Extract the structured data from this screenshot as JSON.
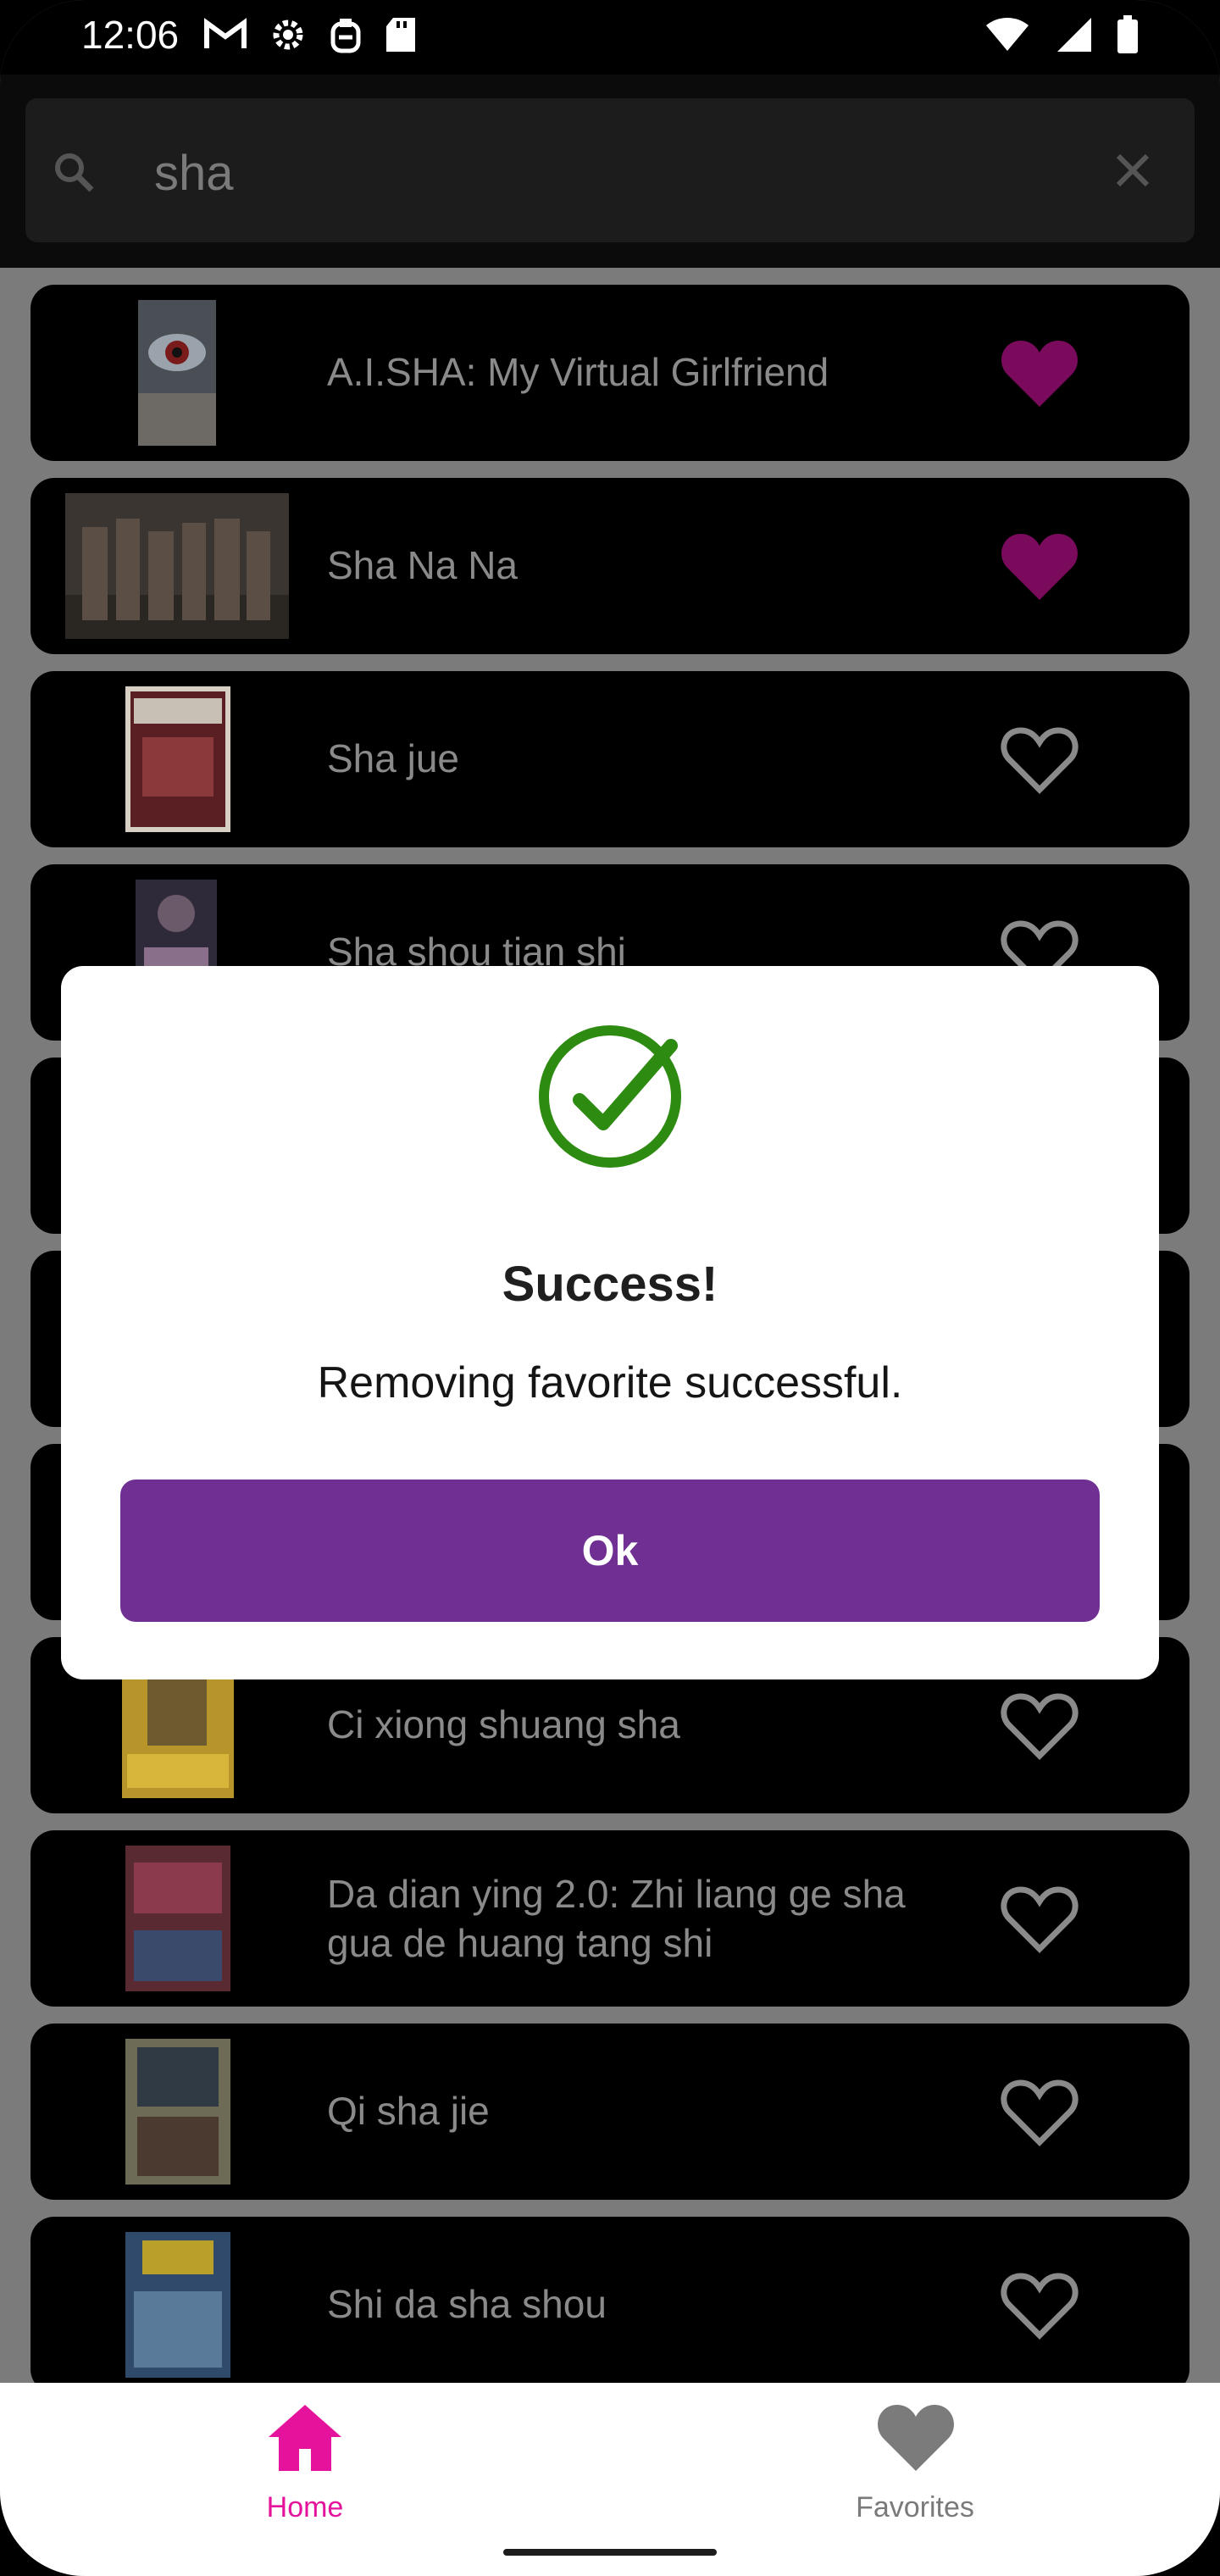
{
  "status_bar": {
    "time": "12:06",
    "left_icons": [
      "gmail-icon",
      "settings-icon",
      "clipboard-icon",
      "sd-card-icon"
    ],
    "right_icons": [
      "wifi-icon",
      "signal-icon",
      "battery-icon"
    ]
  },
  "search": {
    "value": "sha",
    "search_icon": "search-icon",
    "clear_icon": "close-icon"
  },
  "movies": [
    {
      "title": "A.I.SHA: My Virtual Girlfriend",
      "favorite": true
    },
    {
      "title": "Sha Na Na",
      "favorite": true
    },
    {
      "title": "Sha jue",
      "favorite": false
    },
    {
      "title": "Sha shou tian shi",
      "favorite": false
    },
    {
      "title": "Ci xiong shuang sha",
      "favorite": false
    },
    {
      "title": "Da dian ying 2.0: Zhi liang ge sha gua de huang tang shi",
      "favorite": false
    },
    {
      "title": "Qi sha jie",
      "favorite": false
    },
    {
      "title": "Shi da sha shou",
      "favorite": false
    }
  ],
  "dialog": {
    "icon": "check-circle-icon",
    "title": "Success!",
    "message": "Removing favorite successful.",
    "ok_label": "Ok"
  },
  "bottom_nav": {
    "home_label": "Home",
    "favorites_label": "Favorites",
    "active": "home"
  },
  "colors": {
    "accent_pink": "#e5139c",
    "favorite_heart_dimmed": "#7a0a5c",
    "button_purple": "#6f2f93",
    "success_green": "#2e8b12"
  }
}
